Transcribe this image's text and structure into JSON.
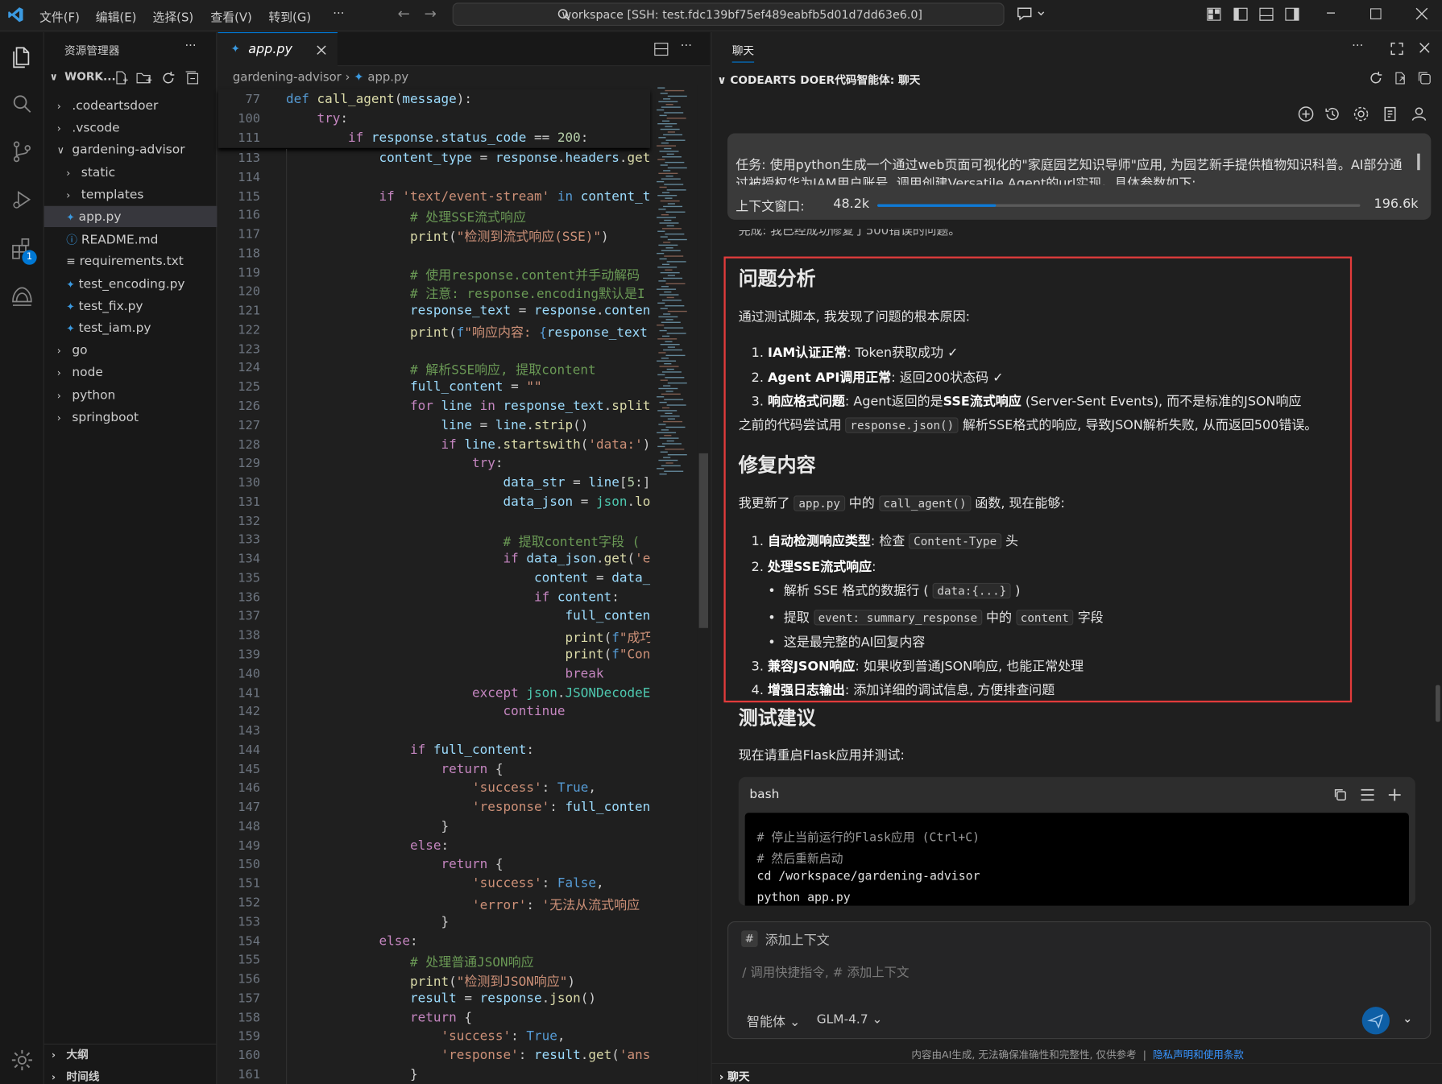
{
  "titlebar": {
    "menus": [
      "文件(F)",
      "编辑(E)",
      "选择(S)",
      "查看(V)",
      "转到(G)",
      "···"
    ],
    "search": "workspace [SSH: test.fdc139bf75ef489eabfb5d01d7dd63e6.0]"
  },
  "sidebar": {
    "title": "资源管理器",
    "workspace": "WORK...",
    "items": [
      {
        "label": ".codeartsdoer",
        "type": "folder",
        "open": false
      },
      {
        "label": ".vscode",
        "type": "folder",
        "open": false
      },
      {
        "label": "gardening-advisor",
        "type": "folder",
        "open": true
      },
      {
        "label": "static",
        "type": "folder",
        "open": false
      },
      {
        "label": "templates",
        "type": "folder",
        "open": false
      },
      {
        "label": "app.py",
        "type": "py",
        "selected": true
      },
      {
        "label": "README.md",
        "type": "info"
      },
      {
        "label": "requirements.txt",
        "type": "txt"
      },
      {
        "label": "test_encoding.py",
        "type": "py"
      },
      {
        "label": "test_fix.py",
        "type": "py"
      },
      {
        "label": "test_iam.py",
        "type": "py"
      },
      {
        "label": "go",
        "type": "folder",
        "open": false
      },
      {
        "label": "node",
        "type": "folder",
        "open": false
      },
      {
        "label": "python",
        "type": "folder",
        "open": false
      },
      {
        "label": "springboot",
        "type": "folder",
        "open": false
      }
    ],
    "outline": "大纲",
    "timeline": "时间线",
    "badge": "1"
  },
  "editor": {
    "tab": "app.py",
    "breadcrumb": [
      "gardening-advisor",
      "app.py"
    ],
    "sticky": [
      {
        "n": "77",
        "html": "<span class=\"kw\">def</span> <span class=\"fn\">call_agent</span>(<span class=\"var\">message</span>):"
      },
      {
        "n": "100",
        "html": "    <span class=\"kw2\">try</span>:"
      },
      {
        "n": "111",
        "html": "        <span class=\"kw2\">if</span> <span class=\"var\">response</span>.<span class=\"var\">status_code</span> == <span class=\"num\">200</span>:"
      }
    ],
    "lines": [
      {
        "n": "113",
        "html": "            <span class=\"var\">content_type</span> = <span class=\"var\">response</span>.<span class=\"var\">headers</span>.<span class=\"fn\">get</span>"
      },
      {
        "n": "114",
        "html": ""
      },
      {
        "n": "115",
        "html": "            <span class=\"kw2\">if</span> <span class=\"str\">'text/event-stream'</span> <span class=\"kw\">in</span> <span class=\"var\">content_t</span>"
      },
      {
        "n": "116",
        "html": "                <span class=\"cm\"># 处理SSE流式响应</span>"
      },
      {
        "n": "117",
        "html": "                <span class=\"fn\">print</span>(<span class=\"str\">\"检测到流式响应(SSE)\"</span>)"
      },
      {
        "n": "118",
        "html": ""
      },
      {
        "n": "119",
        "html": "                <span class=\"cm\"># 使用response.content并手动解码</span>"
      },
      {
        "n": "120",
        "html": "                <span class=\"cm\"># 注意: response.encoding默认是I</span>"
      },
      {
        "n": "121",
        "html": "                <span class=\"var\">response_text</span> = <span class=\"var\">response</span>.<span class=\"var\">conten</span>"
      },
      {
        "n": "122",
        "html": "                <span class=\"fn\">print</span>(<span class=\"kw\">f</span><span class=\"str\">\"响应内容: </span><span class=\"kw\">{</span><span class=\"var\">response_text</span>"
      },
      {
        "n": "123",
        "html": ""
      },
      {
        "n": "124",
        "html": "                <span class=\"cm\"># 解析SSE响应, 提取content</span>"
      },
      {
        "n": "125",
        "html": "                <span class=\"var\">full_content</span> = <span class=\"str\">\"\"</span>"
      },
      {
        "n": "126",
        "html": "                <span class=\"kw2\">for</span> <span class=\"var\">line</span> <span class=\"kw2\">in</span> <span class=\"var\">response_text</span>.<span class=\"fn\">split</span>"
      },
      {
        "n": "127",
        "html": "                    <span class=\"var\">line</span> = <span class=\"var\">line</span>.<span class=\"fn\">strip</span>()"
      },
      {
        "n": "128",
        "html": "                    <span class=\"kw2\">if</span> <span class=\"var\">line</span>.<span class=\"fn\">startswith</span>(<span class=\"str\">'data:'</span>)"
      },
      {
        "n": "129",
        "html": "                        <span class=\"kw2\">try</span>:"
      },
      {
        "n": "130",
        "html": "                            <span class=\"var\">data_str</span> = <span class=\"var\">line</span>[<span class=\"num\">5</span>:]"
      },
      {
        "n": "131",
        "html": "                            <span class=\"var\">data_json</span> = <span class=\"cls\">json</span>.<span class=\"fn\">lo</span>"
      },
      {
        "n": "132",
        "html": ""
      },
      {
        "n": "133",
        "html": "                            <span class=\"cm\"># 提取content字段 (</span>"
      },
      {
        "n": "134",
        "html": "                            <span class=\"kw2\">if</span> <span class=\"var\">data_json</span>.<span class=\"fn\">get</span>(<span class=\"str\">'e</span>"
      },
      {
        "n": "135",
        "html": "                                <span class=\"var\">content</span> = <span class=\"var\">data_</span>"
      },
      {
        "n": "136",
        "html": "                                <span class=\"kw2\">if</span> <span class=\"var\">content</span>:"
      },
      {
        "n": "137",
        "html": "                                    <span class=\"var\">full_conten</span>"
      },
      {
        "n": "138",
        "html": "                                    <span class=\"fn\">print</span>(<span class=\"kw\">f</span><span class=\"str\">\"成巧</span>"
      },
      {
        "n": "139",
        "html": "                                    <span class=\"fn\">print</span>(<span class=\"kw\">f</span><span class=\"str\">\"Con</span>"
      },
      {
        "n": "140",
        "html": "                                    <span class=\"kw2\">break</span>"
      },
      {
        "n": "141",
        "html": "                        <span class=\"kw2\">except</span> <span class=\"cls\">json</span>.<span class=\"cls\">JSONDecodeE</span>"
      },
      {
        "n": "142",
        "html": "                            <span class=\"kw2\">continue</span>"
      },
      {
        "n": "143",
        "html": ""
      },
      {
        "n": "144",
        "html": "                <span class=\"kw2\">if</span> <span class=\"var\">full_content</span>:"
      },
      {
        "n": "145",
        "html": "                    <span class=\"kw2\">return</span> {"
      },
      {
        "n": "146",
        "html": "                        <span class=\"str\">'success'</span>: <span class=\"kw\">True</span>,"
      },
      {
        "n": "147",
        "html": "                        <span class=\"str\">'response'</span>: <span class=\"var\">full_conten</span>"
      },
      {
        "n": "148",
        "html": "                    }"
      },
      {
        "n": "149",
        "html": "                <span class=\"kw2\">else</span>:"
      },
      {
        "n": "150",
        "html": "                    <span class=\"kw2\">return</span> {"
      },
      {
        "n": "151",
        "html": "                        <span class=\"str\">'success'</span>: <span class=\"kw\">False</span>,"
      },
      {
        "n": "152",
        "html": "                        <span class=\"str\">'error'</span>: <span class=\"str\">'无法从流式响应</span>"
      },
      {
        "n": "153",
        "html": "                    }"
      },
      {
        "n": "154",
        "html": "            <span class=\"kw2\">else</span>:"
      },
      {
        "n": "155",
        "html": "                <span class=\"cm\"># 处理普通JSON响应</span>"
      },
      {
        "n": "156",
        "html": "                <span class=\"fn\">print</span>(<span class=\"str\">\"检测到JSON响应\"</span>)"
      },
      {
        "n": "157",
        "html": "                <span class=\"var\">result</span> = <span class=\"var\">response</span>.<span class=\"fn\">json</span>()"
      },
      {
        "n": "158",
        "html": "                <span class=\"kw2\">return</span> {"
      },
      {
        "n": "159",
        "html": "                    <span class=\"str\">'success'</span>: <span class=\"kw\">True</span>,"
      },
      {
        "n": "160",
        "html": "                    <span class=\"str\">'response'</span>: <span class=\"var\">result</span>.<span class=\"fn\">get</span>(<span class=\"str\">'ans</span>"
      },
      {
        "n": "161",
        "html": "                }"
      }
    ]
  },
  "chat": {
    "tab": "聊天",
    "header": "CODEARTS DOER代码智能体: 聊天",
    "task_text": "任务: 使用python生成一个通过web页面可视化的\"家庭园艺知识导师\"应用, 为园艺新手提供植物知识科普。AI部分通",
    "task_text2": "过被授权华为IAM用户账号, 调用创建Versatile Agent的url实现。具体参数如下:",
    "context_label": "上下文窗口:",
    "context_used": "48.2k",
    "context_max": "196.6k",
    "context_fraction": 0.245,
    "prev_line": "完成: 我已经成功修复了500错误的问题。",
    "h_analysis": "问题分析",
    "intro1": "通过测试脚本, 我发现了问题的根本原因:",
    "a1_b": "IAM认证正常",
    "a1_t": ": Token获取成功 ✓",
    "a2_b": "Agent API调用正常",
    "a2_t": ": 返回200状态码 ✓",
    "a3_b": "响应格式问题",
    "a3_t": ": Agent返回的是",
    "a3_b2": "SSE流式响应",
    "a3_t2": " (Server-Sent Events), 而不是标准的JSON响应",
    "prev_code_pre": "之前的代码尝试用",
    "prev_code_code": "response.json()",
    "prev_code_post": "解析SSE格式的响应, 导致JSON解析失败, 从而返回500错误。",
    "h_fix": "修复内容",
    "fix_pre": "我更新了",
    "fix_code1": "app.py",
    "fix_mid": "中的",
    "fix_code2": "call_agent()",
    "fix_post": "函数, 现在能够:",
    "f1_b": "自动检测响应类型",
    "f1_t": ": 检查",
    "f1_code": "Content-Type",
    "f1_t2": "头",
    "f2_b": "处理SSE流式响应",
    "f2_t": ":",
    "b1_pre": "解析 SSE 格式的数据行 (",
    "b1_code": "data:{...}",
    "b1_post": ")",
    "b2_pre": "提取",
    "b2_code1": "event: summary_response",
    "b2_mid": "中的",
    "b2_code2": "content",
    "b2_post": "字段",
    "b3": "这是最完整的AI回复内容",
    "f3_b": "兼容JSON响应",
    "f3_t": ": 如果收到普通JSON响应, 也能正常处理",
    "f4_b": "增强日志输出",
    "f4_t": ": 添加详细的调试信息, 方便排查问题",
    "h_test": "测试建议",
    "test_intro": "现在请重启Flask应用并测试:",
    "code_lang": "bash",
    "code_lines": [
      "# 停止当前运行的Flask应用 (Ctrl+C)",
      "# 然后重新启动",
      "cd /workspace/gardening-advisor",
      "python app.py"
    ],
    "input_context": "添加上下文",
    "input_placeholder": "/ 调用快捷指令, # 添加上下文",
    "mode": "智能体",
    "model": "GLM-4.7",
    "disclaimer": "内容由AI生成, 无法确保准确性和完整性, 仅供参考",
    "disclaimer_link": "隐私声明和使用条款",
    "footer": "聊天"
  }
}
